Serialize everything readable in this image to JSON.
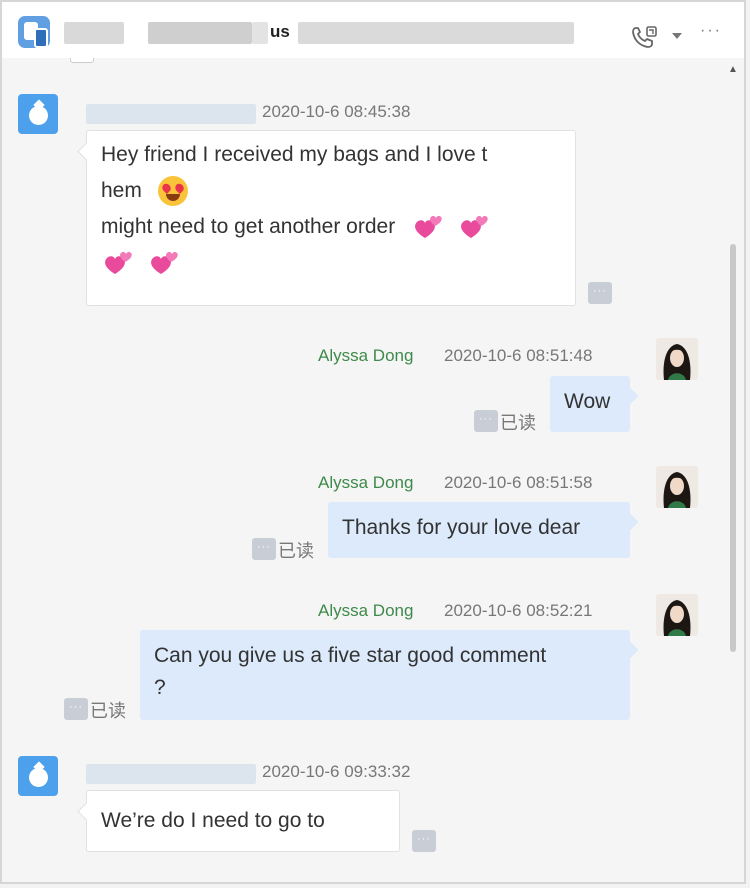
{
  "titlebar": {
    "visible_title_fragment": "us",
    "icons": {
      "app": "chat-app-icon",
      "call": "phone-call-icon",
      "dropdown": "chevron-down-icon",
      "more": "more-icon"
    },
    "more_glyph": "···"
  },
  "status": {
    "read_label": "已读",
    "more_glyph": "···"
  },
  "messages": [
    {
      "direction": "incoming",
      "time": "2020-10-6 08:45:38",
      "line1": "Hey friend I received my bags and I love t",
      "line2": "hem",
      "line3": " might need to get another order",
      "emojis": [
        "smiling-face-with-heart-eyes",
        "revolving-hearts",
        "revolving-hearts",
        "revolving-hearts",
        "revolving-hearts"
      ]
    },
    {
      "direction": "outgoing",
      "sender": "Alyssa Dong",
      "time": "2020-10-6 08:51:48",
      "text": "Wow"
    },
    {
      "direction": "outgoing",
      "sender": "Alyssa Dong",
      "time": "2020-10-6 08:51:58",
      "text": "Thanks for your love dear"
    },
    {
      "direction": "outgoing",
      "sender": "Alyssa Dong",
      "time": "2020-10-6 08:52:21",
      "text": "Can you give us a five star good comment\n?"
    },
    {
      "direction": "incoming",
      "time": "2020-10-6 09:33:32",
      "text": "We’re do I need to go to"
    }
  ],
  "colors": {
    "incoming_bubble": "#ffffff",
    "outgoing_bubble": "#dceafb",
    "sender_name": "#3e8a4a",
    "bot_avatar": "#4da0ec",
    "background": "#f5f5f5"
  }
}
